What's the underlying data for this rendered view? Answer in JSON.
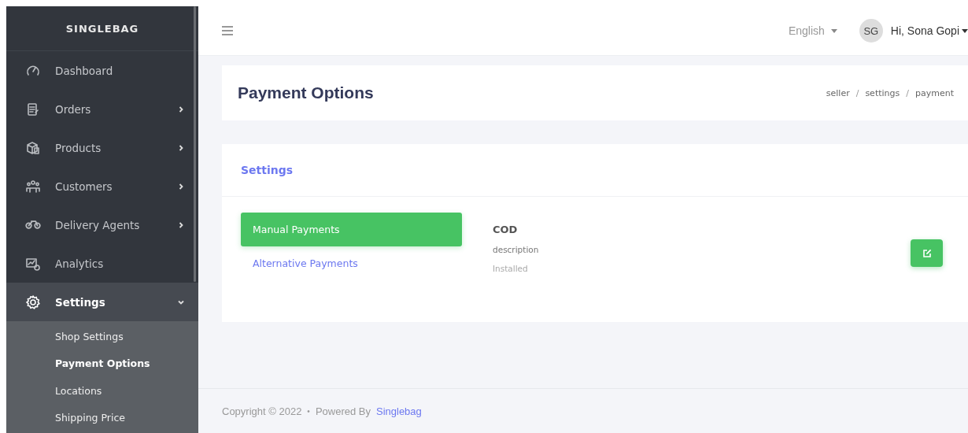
{
  "sidebar": {
    "brand": "SINGLEBAG",
    "items": [
      {
        "label": "Dashboard",
        "kind": "gauge",
        "has_submenu": false,
        "expanded": false
      },
      {
        "label": "Orders",
        "kind": "clipboard",
        "has_submenu": true,
        "expanded": false
      },
      {
        "label": "Products",
        "kind": "boxes",
        "has_submenu": true,
        "expanded": false
      },
      {
        "label": "Customers",
        "kind": "people",
        "has_submenu": true,
        "expanded": false
      },
      {
        "label": "Delivery Agents",
        "kind": "motorbike",
        "has_submenu": true,
        "expanded": false
      },
      {
        "label": "Analytics",
        "kind": "chart",
        "has_submenu": false,
        "expanded": false
      },
      {
        "label": "Settings",
        "kind": "gear",
        "has_submenu": true,
        "expanded": true,
        "children": [
          {
            "label": "Shop Settings",
            "selected": false
          },
          {
            "label": "Payment Options",
            "selected": true
          },
          {
            "label": "Locations",
            "selected": false
          },
          {
            "label": "Shipping Price",
            "selected": false
          }
        ]
      }
    ]
  },
  "topbar": {
    "language": "English",
    "avatar": "SG",
    "user": "Hi, Sona Gopi"
  },
  "page_header": {
    "title": "Payment Options",
    "breadcrumb": [
      {
        "text": "seller",
        "kind": "link"
      },
      {
        "text": "/",
        "kind": "separator"
      },
      {
        "text": "settings",
        "kind": "link"
      },
      {
        "text": "/",
        "kind": "separator"
      },
      {
        "text": "payment",
        "kind": "link"
      }
    ]
  },
  "settings_card": {
    "title": "Settings",
    "tabs": [
      {
        "label": "Manual Payments",
        "selected": true
      },
      {
        "label": "Alternative Payments",
        "selected": false
      }
    ],
    "method": {
      "name": "COD",
      "description": "description",
      "status": "Installed"
    }
  },
  "footer": {
    "copyright": "Copyright © 2022",
    "separator": "•",
    "powered": "Powered By",
    "link": "Singlebag"
  }
}
